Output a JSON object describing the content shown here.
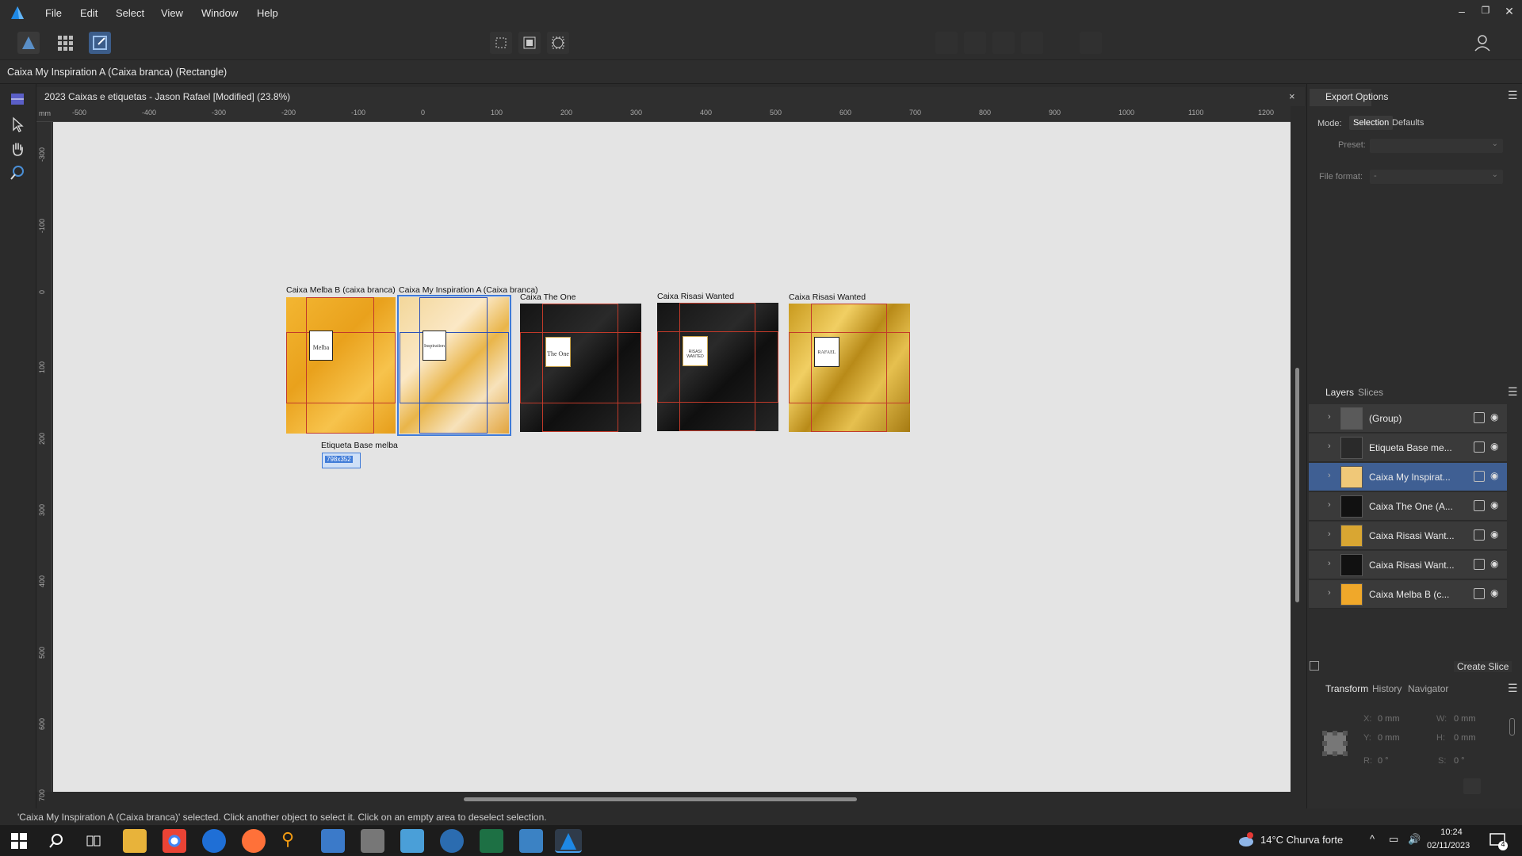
{
  "menubar": {
    "items": [
      "File",
      "Edit",
      "Select",
      "View",
      "Window",
      "Help"
    ]
  },
  "context": {
    "title": "Caixa My Inspiration A (Caixa branca) (Rectangle)"
  },
  "document": {
    "tab_title": "2023 Caixas e etiquetas - Jason Rafael [Modified] (23.8%)",
    "close": "×"
  },
  "rulers": {
    "unit": "mm",
    "h_ticks": [
      "-500",
      "-400",
      "-300",
      "-200",
      "-100",
      "0",
      "100",
      "200",
      "300",
      "400",
      "500",
      "600",
      "700",
      "800",
      "900",
      "1000",
      "1100",
      "1200"
    ],
    "v_ticks": [
      "-300",
      "-100",
      "0",
      "100",
      "200",
      "300",
      "400",
      "500",
      "600",
      "700"
    ]
  },
  "artboards": [
    {
      "label": "Caixa Melba B (caixa branca)",
      "card_text": "Melba"
    },
    {
      "label": "Caixa My Inspiration A (Caixa branca)",
      "card_text": "Inspiration"
    },
    {
      "label": "Caixa The One",
      "card_text": "The One"
    },
    {
      "label": "Caixa Risasi Wanted",
      "card_text": "RISASI WANTED"
    },
    {
      "label": "Caixa Risasi Wanted",
      "card_text": "RAFAEL"
    }
  ],
  "label_artboard": {
    "label": "Etiqueta Base melba",
    "size_badge": "798x352"
  },
  "export_panel": {
    "title": "Export Options",
    "mode_label": "Mode:",
    "mode_selection": "Selection",
    "mode_defaults": "Defaults",
    "preset_label": "Preset:",
    "file_format_label": "File format:",
    "file_format_value": "-"
  },
  "layers_panel": {
    "tab_layers": "Layers",
    "tab_slices": "Slices",
    "rows": [
      {
        "name": "(Group)",
        "selected": false
      },
      {
        "name": "Etiqueta Base me...",
        "selected": false
      },
      {
        "name": "Caixa My Inspirat...",
        "selected": true
      },
      {
        "name": "Caixa The One (A...",
        "selected": false
      },
      {
        "name": "Caixa Risasi Want...",
        "selected": false
      },
      {
        "name": "Caixa Risasi Want...",
        "selected": false
      },
      {
        "name": "Caixa Melba B (c...",
        "selected": false
      }
    ],
    "create_slice": "Create Slice"
  },
  "transform_panel": {
    "tab_transform": "Transform",
    "tab_history": "History",
    "tab_navigator": "Navigator",
    "x_label": "X:",
    "x_value": "0 mm",
    "y_label": "Y:",
    "y_value": "0 mm",
    "w_label": "W:",
    "w_value": "0 mm",
    "h_label": "H:",
    "h_value": "0 mm",
    "r_label": "R:",
    "r_value": "0 °",
    "s_label": "S:",
    "s_value": "0 °"
  },
  "status": {
    "text": "'Caixa My Inspiration A (Caixa branca)' selected. Click another object to select it. Click on an empty area to deselect selection."
  },
  "taskbar": {
    "weather": "14°C  Churva forte",
    "time": "10:24",
    "date": "02/11/2023",
    "notif_count": "4"
  },
  "colors": {
    "accent": "#3f7bd8",
    "selected_row": "#3f5f93",
    "canvas_bg": "#e4e4e4"
  }
}
